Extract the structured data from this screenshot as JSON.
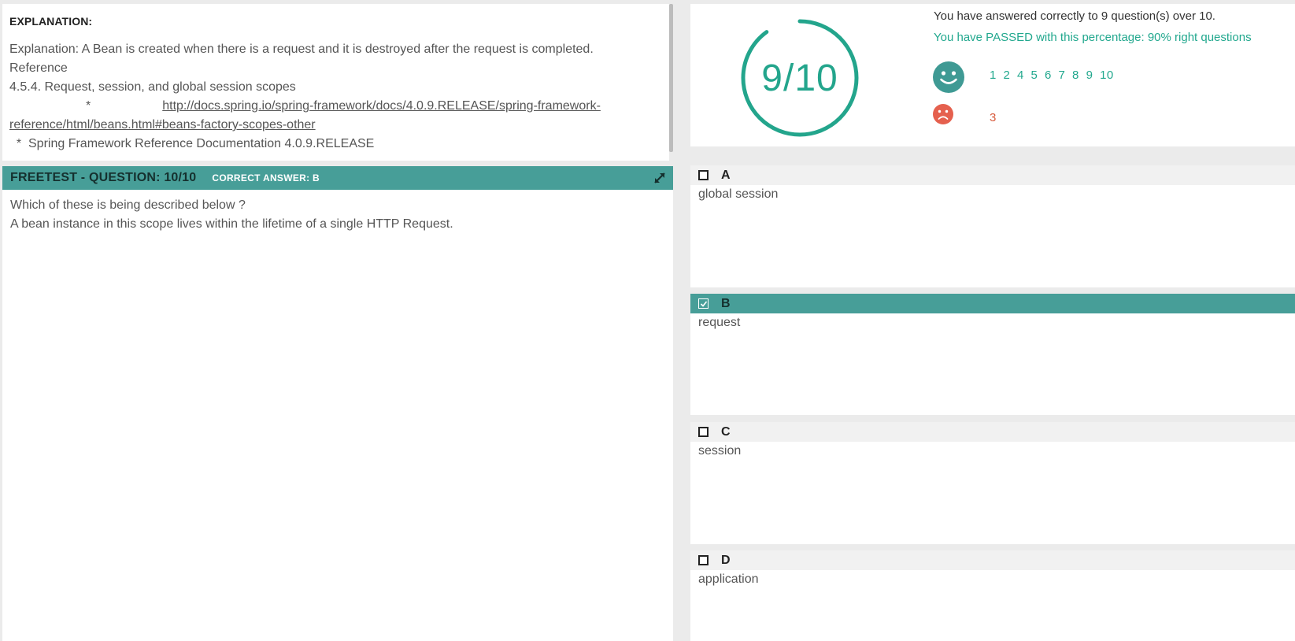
{
  "explanation": {
    "heading": "EXPLANATION:",
    "line1": "Explanation: A Bean is created when there is a request and it is destroyed  after the request is completed.",
    "line2": "Reference",
    "line3": "4.5.4. Request, session, and global session scopes",
    "bullet": "*",
    "link_part1": "http://docs.spring.io/spring-framework/docs/4.0.9.RELEASE/spring-framework-",
    "link_part2": "reference/html/beans.html#beans-factory-scopes-other",
    "line6": "  *  Spring Framework Reference Documentation 4.0.9.RELEASE"
  },
  "question": {
    "title": "FREETEST - QUESTION: 10/10",
    "correct_answer": "CORRECT ANSWER: B",
    "text1": "Which of these is being described below ?",
    "text2": "A bean instance in this scope lives within the lifetime of a single HTTP Request."
  },
  "score": {
    "fraction": "9/10",
    "progress": 0.9,
    "summary": "You have answered correctly to 9 question(s) over 10.",
    "passed": "You have PASSED with this percentage: 90% right questions",
    "right_questions": "1 2 4 5 6 7 8 9 10",
    "wrong_questions": "3",
    "accent_color": "#23a58c",
    "wrong_color": "#e5604e"
  },
  "answers": [
    {
      "letter": "A",
      "text": "global session",
      "checked": false
    },
    {
      "letter": "B",
      "text": "request",
      "checked": true
    },
    {
      "letter": "C",
      "text": "session",
      "checked": false
    },
    {
      "letter": "D",
      "text": "application",
      "checked": false
    }
  ],
  "icons": {
    "happy": "smiley-face-icon",
    "sad": "sad-face-icon",
    "expand": "expand-arrows-icon",
    "checkbox": "checkbox-icon"
  }
}
